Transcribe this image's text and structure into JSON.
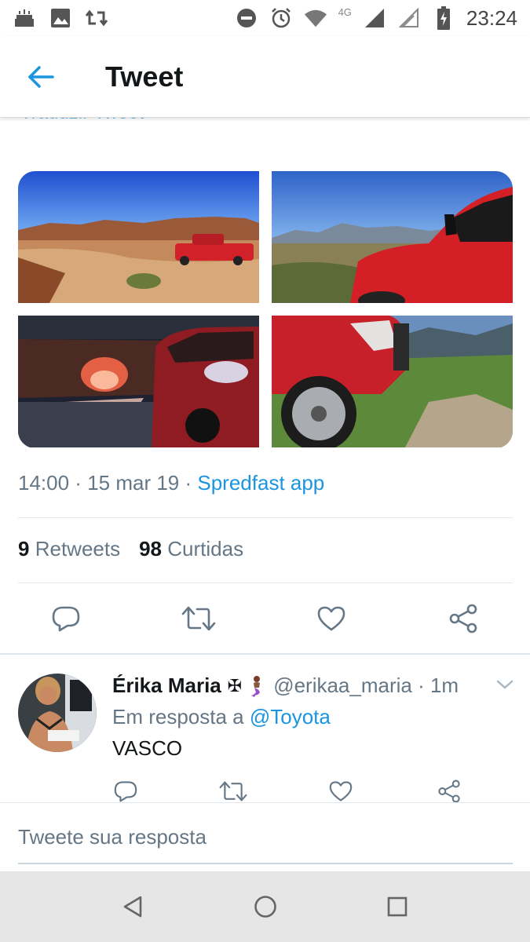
{
  "status_bar": {
    "time": "23:24",
    "network": "4G",
    "icons": [
      "cake-icon",
      "image-icon",
      "retweet-notification-icon",
      "dnd-icon",
      "alarm-icon",
      "wifi-icon",
      "signal-icon",
      "signal-empty-icon",
      "battery-icon"
    ]
  },
  "app_bar": {
    "title": "Tweet",
    "back_icon": "arrow-left-icon"
  },
  "clipped_text": "Traduzir Tweet",
  "photos": [
    {
      "subject": "red pickup truck in desert canyon"
    },
    {
      "subject": "red pickup front with mountains"
    },
    {
      "subject": "red pickup at night by campfire"
    },
    {
      "subject": "red pickup wheel on rocks"
    }
  ],
  "meta": {
    "time": "14:00",
    "sep1": " · ",
    "date": "15 mar 19",
    "sep2": " · ",
    "app": "Spredfast app"
  },
  "counts": {
    "retweets_num": "9",
    "retweets_label": "Retweets",
    "likes_num": "98",
    "likes_label": "Curtidas"
  },
  "reply": {
    "name": "Érika Maria",
    "badge": "✠",
    "handle": "@erikaa_maria · 1m",
    "reply_prefix": "Em resposta a ",
    "reply_mention": "@Toyota",
    "text": "VASCO"
  },
  "compose": {
    "placeholder": "Tweete sua resposta"
  },
  "colors": {
    "accent": "#1b95e0",
    "secondary_text": "#657786",
    "divider": "#e1e8ed",
    "icon": "#657786"
  }
}
